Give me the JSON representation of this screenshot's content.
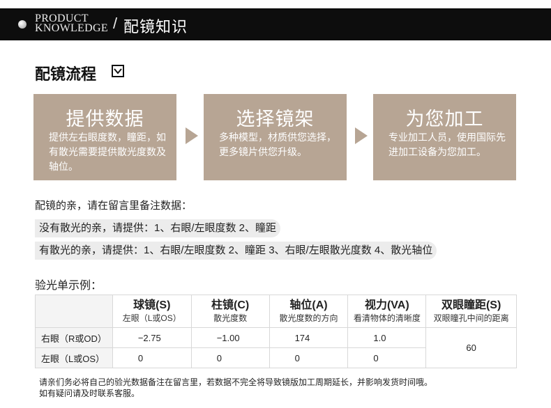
{
  "header": {
    "en_line1": "PRODUCT",
    "en_line2": "KNOWLEDGE",
    "slash": "/",
    "cn_title": "配镜知识"
  },
  "section": {
    "title": "配镜流程",
    "check_icon": "checkbox-down-icon"
  },
  "steps": [
    {
      "title": "提供数据",
      "desc": "提供左右眼度数，瞳距，如有散光需要提供散光度数及轴位。"
    },
    {
      "title": "选择镜架",
      "desc": "多种模型，材质供您选择，更多镜片供您升级。"
    },
    {
      "title": "为您加工",
      "desc": "专业加工人员，使用国际先进加工设备为您加工。"
    }
  ],
  "intro": "配镜的亲，请在留言里备注数据：",
  "notes": [
    "没有散光的亲，请提供：1、右眼/左眼度数 2、瞳距",
    "有散光的亲，请提供：1、右眼/左眼度数 2、瞳距 3、右眼/左眼散光度数 4、散光轴位"
  ],
  "sample_title": "验光单示例：",
  "table": {
    "headers": [
      {
        "title": "球镜(S)",
        "sub": "左眼（L或OS）"
      },
      {
        "title": "柱镜(C)",
        "sub": "散光度数"
      },
      {
        "title": "轴位(A)",
        "sub": "散光度数的方向"
      },
      {
        "title": "视力(VA)",
        "sub": "看清物体的清晰度"
      },
      {
        "title": "双眼瞳距(S)",
        "sub": "双眼瞳孔中间的距离"
      }
    ],
    "rows": [
      {
        "label": "右眼（R或OD）",
        "s": "−2.75",
        "c": "−1.00",
        "a": "174",
        "va": "1.0"
      },
      {
        "label": "左眼（L或OS）",
        "s": "0",
        "c": "0",
        "a": "0",
        "va": "0"
      }
    ],
    "pd": "60"
  },
  "footer_note_line1": "请亲们务必将自己的验光数据备注在留言里，若数据不完全将导致镜版加工周期延长，并影响发货时间哦。",
  "footer_note_line2": "如有疑问请及时联系客服。",
  "colors": {
    "step_bg": "#b7a594",
    "bar_bg": "#0d0d0d",
    "pill_bg": "#ececec"
  }
}
